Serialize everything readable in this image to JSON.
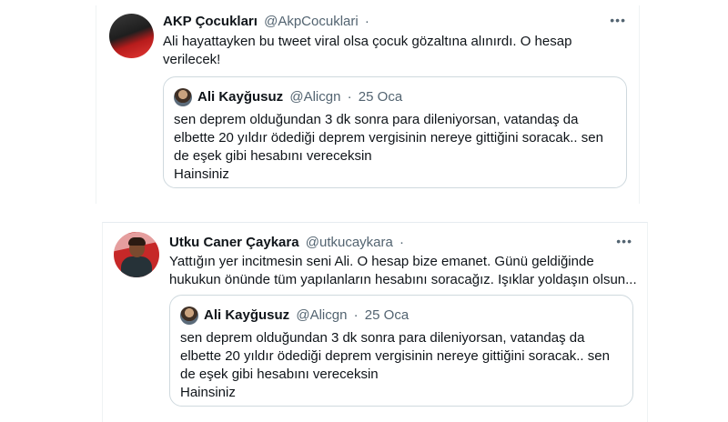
{
  "tweets": [
    {
      "name": "AKP Çocukları",
      "handle": "@AkpCocuklari",
      "separator": "·",
      "more": "•••",
      "text_lines": [
        "Ali hayattayken bu tweet viral olsa çocuk gözaltına alınırdı. O hesap",
        "verilecek!"
      ],
      "quote": {
        "name": "Ali Kayğusuz",
        "handle": "@Alicgn",
        "separator": "·",
        "date": "25 Oca",
        "text_lines": [
          "sen deprem olduğundan 3 dk sonra para dileniyorsan, vatandaş da",
          "elbette 20 yıldır ödediği deprem vergisinin nereye gittiğini soracak.. sen",
          "de eşek gibi hesabını vereceksin",
          "Hainsiniz"
        ]
      }
    },
    {
      "name": "Utku Caner Çaykara",
      "handle": "@utkucaykara",
      "separator": "·",
      "more": "•••",
      "text_lines": [
        "Yattığın yer incitmesin seni Ali. O hesap bize emanet. Günü geldiğinde",
        "hukukun önünde tüm yapılanların hesabını soracağız. Işıklar yoldaşın olsun..."
      ],
      "quote": {
        "name": "Ali Kayğusuz",
        "handle": "@Alicgn",
        "separator": "·",
        "date": "25 Oca",
        "text_lines": [
          "sen deprem olduğundan 3 dk sonra para dileniyorsan, vatandaş da",
          "elbette 20 yıldır ödediği deprem vergisinin nereye gittiğini soracak.. sen",
          "de eşek gibi hesabını vereceksin",
          "Hainsiniz"
        ]
      }
    }
  ]
}
